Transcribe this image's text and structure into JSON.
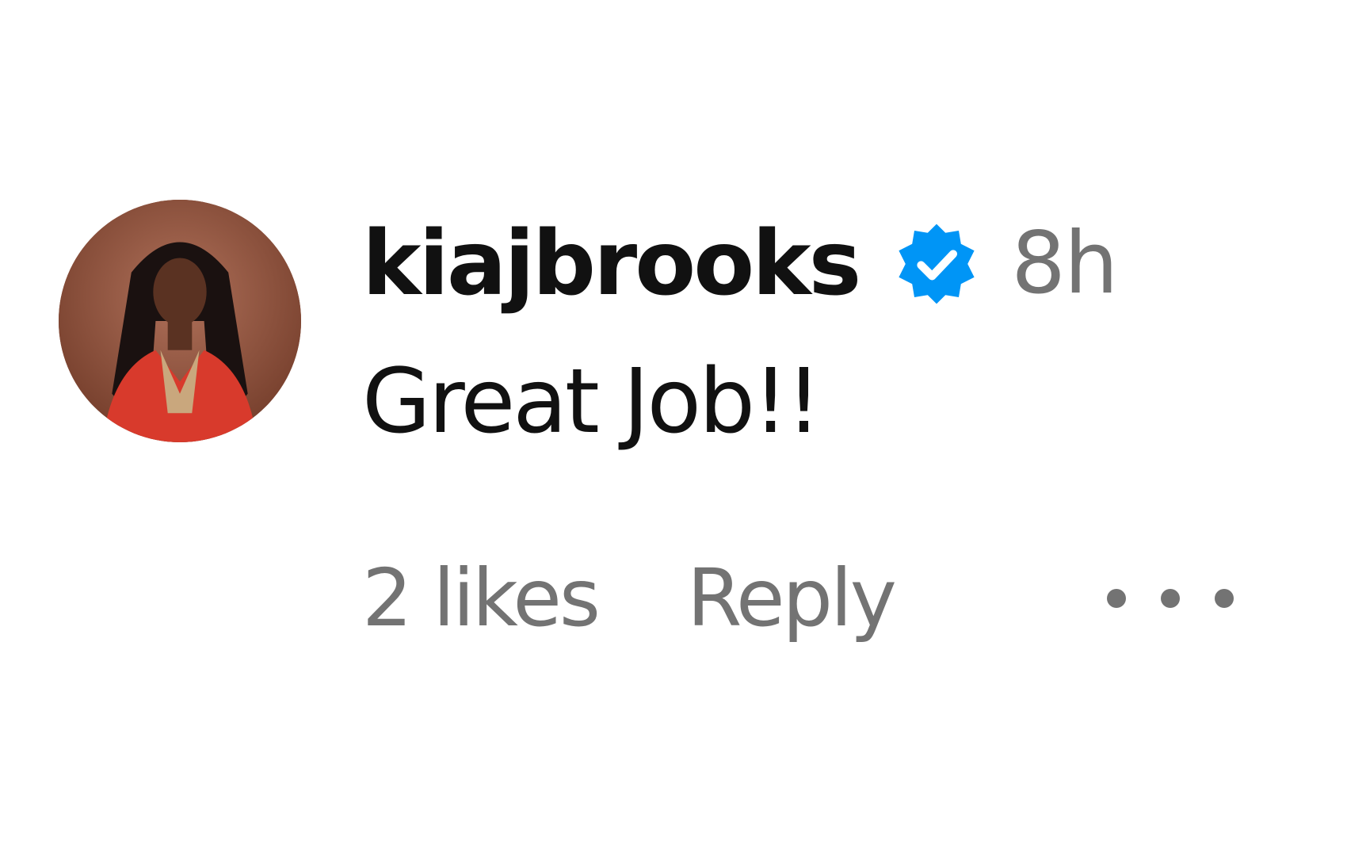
{
  "comment": {
    "username": "kiajbrooks",
    "verified": true,
    "time": "8h",
    "text": "Great Job!!",
    "likes": "2 likes",
    "reply_label": "Reply",
    "more_icon": "more-options-icon"
  },
  "colors": {
    "verified_blue": "#0095f6",
    "text_primary": "#111111",
    "text_secondary": "#737373",
    "background": "#ffffff"
  }
}
